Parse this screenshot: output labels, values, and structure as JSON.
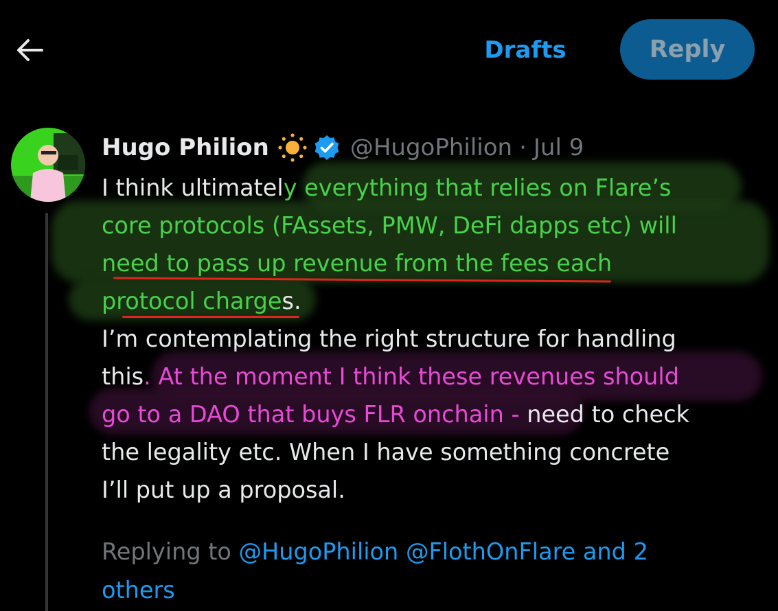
{
  "header": {
    "back_icon": "arrow-left-icon",
    "drafts_label": "Drafts",
    "reply_label": "Reply"
  },
  "tweet": {
    "display_name": "Hugo Philion",
    "name_emoji": "sun-icon",
    "verified_icon": "verified-badge-icon",
    "handle": "@HugoPhilion",
    "separator": "·",
    "date": "Jul 9",
    "body_lines": [
      [
        {
          "text": "I think ultimatel",
          "style": "plain"
        },
        {
          "text": "y everything that relies on Flare’s",
          "style": "green"
        }
      ],
      [
        {
          "text": "core protocols (FAssets, PMW, DeFi dapps etc) will",
          "style": "green"
        }
      ],
      [
        {
          "text": "need to pass up revenue from the fees each",
          "style": "green"
        }
      ],
      [
        {
          "text": "protocol charge",
          "style": "green"
        },
        {
          "text": "s.",
          "style": "plain"
        }
      ],
      [
        {
          "text": "I’m contemplating the right structure for handling",
          "style": "plain"
        }
      ],
      [
        {
          "text": "this",
          "style": "plain"
        },
        {
          "text": ". At the moment I think these revenues should",
          "style": "pink"
        }
      ],
      [
        {
          "text": "go to a DAO that buys FLR onchain - ",
          "style": "pink"
        },
        {
          "text": "need to check",
          "style": "plain"
        }
      ],
      [
        {
          "text": "the legality etc. When I have something concrete",
          "style": "plain"
        }
      ],
      [
        {
          "text": "I’ll put up a proposal.",
          "style": "plain"
        }
      ]
    ],
    "replying_prefix": "Replying to ",
    "mention_1": "@HugoPhilion",
    "mention_2": "@FlothOnFlare",
    "mention_rest_line1": "and 2",
    "mention_rest_line2": "others"
  },
  "colors": {
    "accent_blue": "#1d9bf0",
    "highlight_green": "#48d14a",
    "highlight_pink": "#e84ad7",
    "underline_red": "#e0261c"
  }
}
